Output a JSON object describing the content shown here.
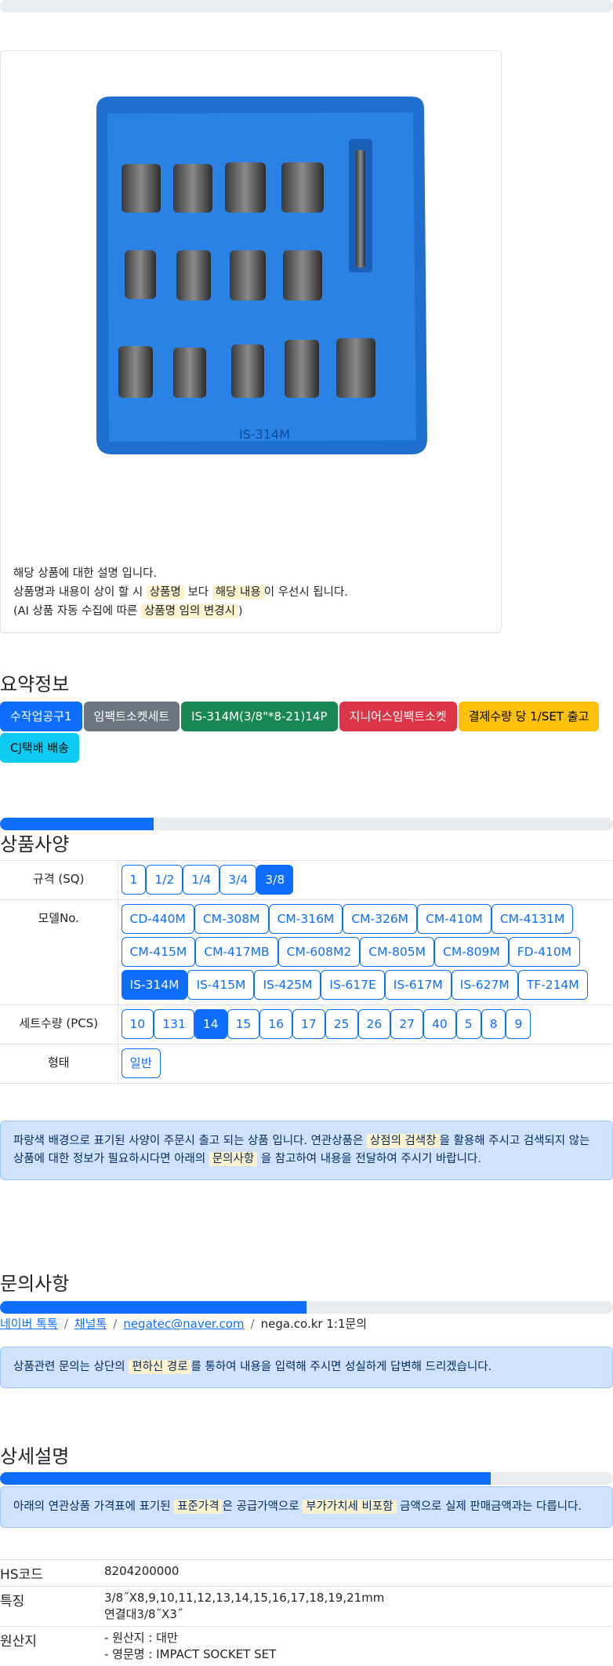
{
  "description": {
    "line1": "해당 상품에 대한 설명 입니다.",
    "line2_a": "상품명과 내용이 상이 할 시",
    "line2_mark1": "상품명",
    "line2_b": "보다",
    "line2_mark2": "해당 내용",
    "line2_c": "이 우선시 됩니다.",
    "line3_a": "(AI 상품 자동 수집에 따른",
    "line3_mark": "상품명 임의 변경시",
    "line3_b": ")"
  },
  "product_image": {
    "label": "IS-314M",
    "tray_color": "#1e6fd0"
  },
  "summary": {
    "title": "요약정보",
    "badges": [
      "수작업공구1",
      "임팩트소켓세트",
      "IS-314M(3/8\"*8-21)14P",
      "지니어스임팩트소켓",
      "결제수량 당 1/SET 출고",
      "CJ택배 배송"
    ]
  },
  "spec_section": {
    "title": "상품사양",
    "progress": 0.25,
    "rows": [
      {
        "label": "규격 (SQ)",
        "options": [
          "1",
          "1/2",
          "1/4",
          "3/4",
          "3/8"
        ],
        "selected": "3/8"
      },
      {
        "label": "모델No.",
        "options": [
          "CD-440M",
          "CM-308M",
          "CM-316M",
          "CM-326M",
          "CM-410M",
          "CM-4131M",
          "CM-415M",
          "CM-417MB",
          "CM-608M2",
          "CM-805M",
          "CM-809M",
          "FD-410M",
          "IS-314M",
          "IS-415M",
          "IS-425M",
          "IS-617E",
          "IS-617M",
          "IS-627M",
          "TF-214M"
        ],
        "selected": "IS-314M"
      },
      {
        "label": "세트수량 (PCS)",
        "options": [
          "10",
          "131",
          "14",
          "15",
          "16",
          "17",
          "25",
          "26",
          "27",
          "40",
          "5",
          "8",
          "9"
        ],
        "selected": "14"
      },
      {
        "label": "형태",
        "options": [
          "일반"
        ],
        "selected": ""
      }
    ],
    "notice_a": "파랑색 배경으로 표기된 사양이 주문시 출고 되는 상품 입니다. 연관상품은",
    "notice_mark1": "상점의 검색창",
    "notice_b": "을 활용해 주시고 검색되지 않는 상품에 대한 정보가 필요하시다면 아래의",
    "notice_mark2": "문의사항",
    "notice_c": "을 참고하여 내용을 전달하여 주시기 바랍니다."
  },
  "inquiry": {
    "title": "문의사항",
    "progress": 0.5,
    "links": [
      "네이버 톡톡",
      "채널톡",
      "negatec@naver.com"
    ],
    "last": "nega.co.kr 1:1문의",
    "notice_a": "상품관련 문의는 상단의",
    "notice_mark": "편하신 경로",
    "notice_b": "를 통하여 내용을 입력해 주시면 성실하게 답변해 드리겠습니다."
  },
  "detail": {
    "title": "상세설명",
    "progress": 0.8,
    "notice_a": "아래의 연관상품 가격표에 표기된",
    "notice_mark1": "표준가격",
    "notice_b": "은 공급가액으로",
    "notice_mark2": "부가가치세 비포함",
    "notice_c": "금액으로 실제 판매금액과는 다릅니다.",
    "hs_label": "HS코드",
    "hs_value": "8204200000",
    "feature_label": "특징",
    "feature_line1": "3/8˝X8,9,10,11,12,13,14,15,16,17,18,19,21mm",
    "feature_line2": "연결대3/8˝X3˝",
    "origin_label": "원산지",
    "origin_line1": "- 원산지 : 대만",
    "origin_line2": "- 영문명 : IMPACT SOCKET SET"
  }
}
